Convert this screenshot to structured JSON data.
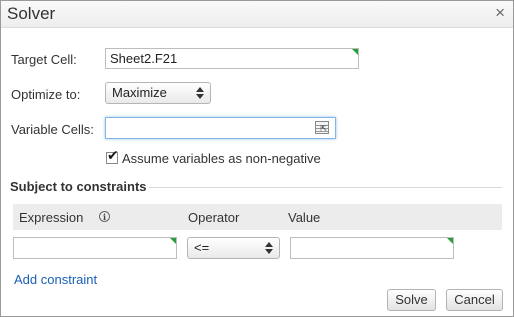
{
  "dialog": {
    "title": "Solver",
    "close_glyph": "×"
  },
  "target_cell": {
    "label": "Target Cell:",
    "value": "Sheet2.F21"
  },
  "optimize": {
    "label": "Optimize to:",
    "selected": "Maximize"
  },
  "variable_cells": {
    "label": "Variable Cells:",
    "value": ""
  },
  "non_negative": {
    "label": "Assume variables as non-negative",
    "checked": true
  },
  "constraints": {
    "section_title": "Subject to constraints",
    "headers": {
      "expression": "Expression",
      "operator": "Operator",
      "value": "Value"
    },
    "row": {
      "expression": "",
      "operator": "<=",
      "value": ""
    },
    "add_label": "Add constraint"
  },
  "buttons": {
    "solve": "Solve",
    "cancel": "Cancel"
  },
  "colors": {
    "corner_marker": "#2a9d3c",
    "link": "#1a5fb4",
    "focus": "#84b4e4"
  }
}
